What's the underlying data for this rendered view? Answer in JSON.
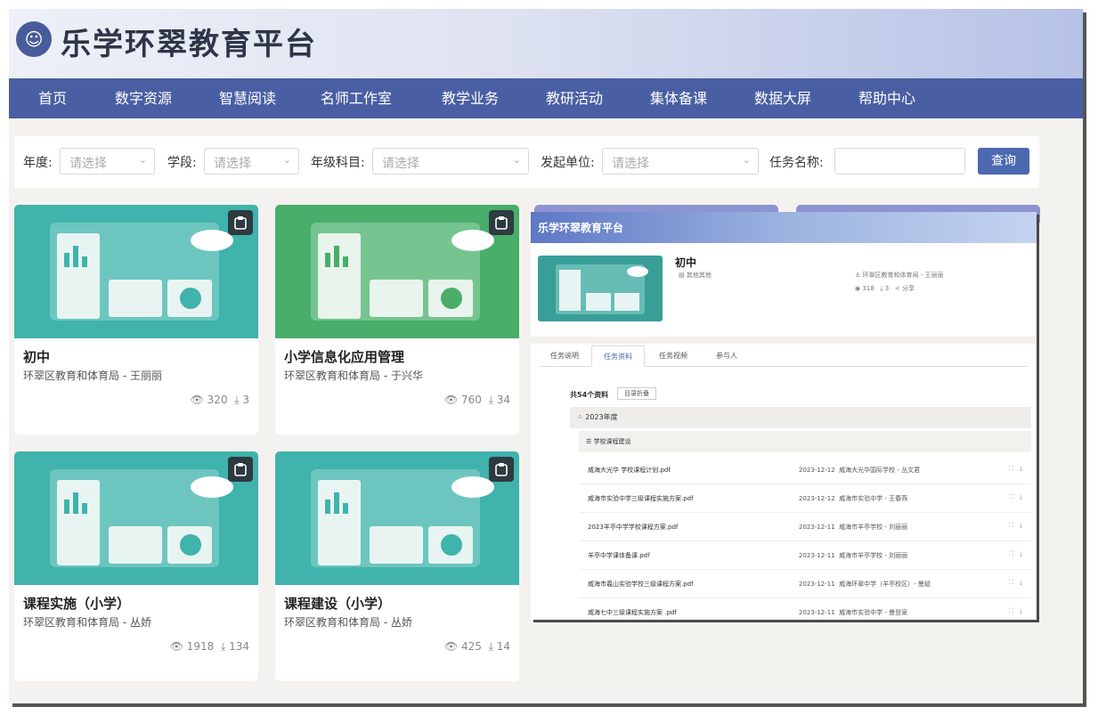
{
  "site": {
    "title": "乐学环翠教育平台"
  },
  "nav": {
    "items": [
      "首页",
      "数字资源",
      "智慧阅读",
      "名师工作室",
      "教学业务",
      "教研活动",
      "集体备课",
      "数据大屏",
      "帮助中心"
    ]
  },
  "filters": {
    "year_label": "年度:",
    "stage_label": "学段:",
    "grade_label": "年级科目:",
    "org_label": "发起单位:",
    "task_label": "任务名称:",
    "placeholder": "请选择",
    "query_label": "查询"
  },
  "cards": [
    {
      "title": "初中",
      "subtitle": "环翠区教育和体育局 - 王丽丽",
      "views": "320",
      "downloads": "3",
      "color": "#3fb3ac"
    },
    {
      "title": "小学信息化应用管理",
      "subtitle": "环翠区教育和体育局 - 于兴华",
      "views": "760",
      "downloads": "34",
      "color": "#48ae6a"
    },
    {
      "title": "课程实施（小学）",
      "subtitle": "环翠区教育和体育局 - 丛娇",
      "views": "1918",
      "downloads": "134",
      "color": "#3fb3ac"
    },
    {
      "title": "课程建设（小学）",
      "subtitle": "环翠区教育和体育局 - 丛娇",
      "views": "425",
      "downloads": "14",
      "color": "#3fb3ac"
    }
  ],
  "detail": {
    "header_title": "乐学环翠教育平台",
    "title": "初中",
    "type": "其他其他",
    "author": "环翠区教育和体育局 - 王丽丽",
    "views": "318",
    "downloads": "3",
    "share": "分享",
    "tabs": [
      "任务说明",
      "任务资料",
      "任务视频",
      "参与人"
    ],
    "count_text": "共54个资料",
    "collapse_label": "目录折叠",
    "year": "2023年度",
    "group": "学校课程建设",
    "files": [
      {
        "name": "威海大光华 学校课程计划.pdf",
        "date": "2023-12-12",
        "org": "威海大光华国际学校 - 丛文君"
      },
      {
        "name": "威海市实验中学三级课程实施方案.pdf",
        "date": "2023-12-12",
        "org": "威海市实验中学 - 王春燕"
      },
      {
        "name": "2023羊亭中学学校课程方案.pdf",
        "date": "2023-12-11",
        "org": "威海市羊亭学校 - 刘丽丽"
      },
      {
        "name": "羊亭中学课体备课.pdf",
        "date": "2023-12-11",
        "org": "威海市羊亭学校 - 刘丽丽"
      },
      {
        "name": "威海市羲山实验学校三级课程方案.pdf",
        "date": "2023-12-11",
        "org": "威海环翠中学（羊亭校区）- 曼斌"
      },
      {
        "name": "威海七中三级课程实施方案 .pdf",
        "date": "2023-12-11",
        "org": "威海市实验中学 - 曼登泉"
      }
    ]
  }
}
